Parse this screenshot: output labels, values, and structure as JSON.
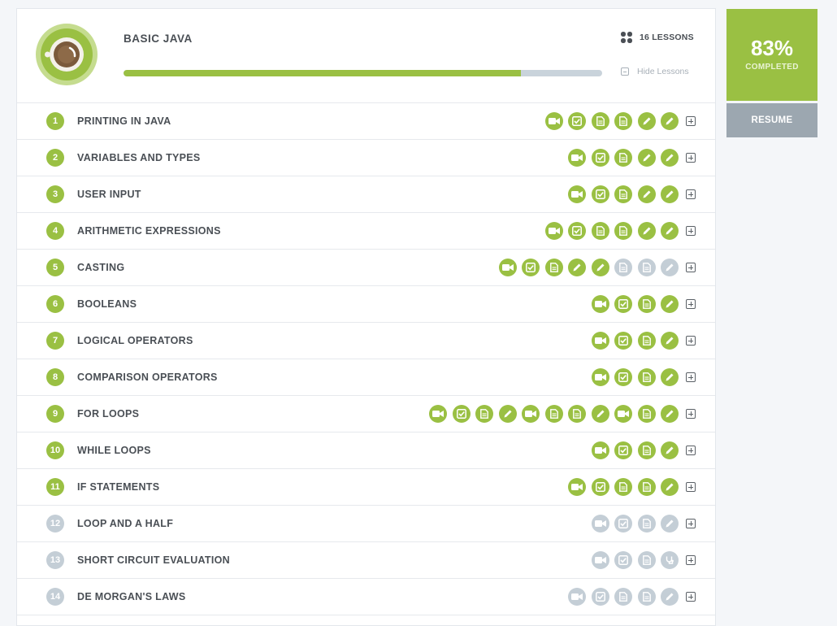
{
  "course": {
    "title": "BASIC JAVA",
    "lessons_count": "16 LESSONS",
    "hide_lessons_label": "Hide Lessons",
    "progress_fraction": 0.83
  },
  "side": {
    "percent": "83%",
    "completed_label": "COMPLETED",
    "resume_label": "RESUME"
  },
  "colors": {
    "accent_green": "#9ac043",
    "incomplete_gray": "#c4ced6",
    "resume_gray": "#9ca7b0"
  },
  "lessons": [
    {
      "num": "1",
      "title": "PRINTING IN JAVA",
      "done": true,
      "items": [
        [
          "video-icon",
          1
        ],
        [
          "checkbox-icon",
          1
        ],
        [
          "document-icon",
          1
        ],
        [
          "document-icon",
          1
        ],
        [
          "pencil-icon",
          1
        ],
        [
          "pencil-icon",
          1
        ]
      ]
    },
    {
      "num": "2",
      "title": "VARIABLES AND TYPES",
      "done": true,
      "items": [
        [
          "video-icon",
          1
        ],
        [
          "checkbox-icon",
          1
        ],
        [
          "document-icon",
          1
        ],
        [
          "pencil-icon",
          1
        ],
        [
          "pencil-icon",
          1
        ]
      ]
    },
    {
      "num": "3",
      "title": "USER INPUT",
      "done": true,
      "items": [
        [
          "video-icon",
          1
        ],
        [
          "checkbox-icon",
          1
        ],
        [
          "document-icon",
          1
        ],
        [
          "pencil-icon",
          1
        ],
        [
          "pencil-icon",
          1
        ]
      ]
    },
    {
      "num": "4",
      "title": "ARITHMETIC EXPRESSIONS",
      "done": true,
      "items": [
        [
          "video-icon",
          1
        ],
        [
          "checkbox-icon",
          1
        ],
        [
          "document-icon",
          1
        ],
        [
          "document-icon",
          1
        ],
        [
          "pencil-icon",
          1
        ],
        [
          "pencil-icon",
          1
        ]
      ]
    },
    {
      "num": "5",
      "title": "CASTING",
      "done": true,
      "items": [
        [
          "video-icon",
          1
        ],
        [
          "checkbox-icon",
          1
        ],
        [
          "document-icon",
          1
        ],
        [
          "pencil-icon",
          1
        ],
        [
          "pencil-icon",
          1
        ],
        [
          "document-icon",
          0
        ],
        [
          "document-icon",
          0
        ],
        [
          "pencil-icon",
          0
        ]
      ]
    },
    {
      "num": "6",
      "title": "BOOLEANS",
      "done": true,
      "items": [
        [
          "video-icon",
          1
        ],
        [
          "checkbox-icon",
          1
        ],
        [
          "document-icon",
          1
        ],
        [
          "pencil-icon",
          1
        ]
      ]
    },
    {
      "num": "7",
      "title": "LOGICAL OPERATORS",
      "done": true,
      "items": [
        [
          "video-icon",
          1
        ],
        [
          "checkbox-icon",
          1
        ],
        [
          "document-icon",
          1
        ],
        [
          "pencil-icon",
          1
        ]
      ]
    },
    {
      "num": "8",
      "title": "COMPARISON OPERATORS",
      "done": true,
      "items": [
        [
          "video-icon",
          1
        ],
        [
          "checkbox-icon",
          1
        ],
        [
          "document-icon",
          1
        ],
        [
          "pencil-icon",
          1
        ]
      ]
    },
    {
      "num": "9",
      "title": "FOR LOOPS",
      "done": true,
      "items": [
        [
          "video-icon",
          1
        ],
        [
          "checkbox-icon",
          1
        ],
        [
          "document-icon",
          1
        ],
        [
          "pencil-icon",
          1
        ],
        [
          "video-icon",
          1
        ],
        [
          "document-icon",
          1
        ],
        [
          "document-icon",
          1
        ],
        [
          "pencil-icon",
          1
        ],
        [
          "video-icon",
          1
        ],
        [
          "document-icon",
          1
        ],
        [
          "pencil-icon",
          1
        ]
      ]
    },
    {
      "num": "10",
      "title": "WHILE LOOPS",
      "done": true,
      "items": [
        [
          "video-icon",
          1
        ],
        [
          "checkbox-icon",
          1
        ],
        [
          "document-icon",
          1
        ],
        [
          "pencil-icon",
          1
        ]
      ]
    },
    {
      "num": "11",
      "title": "IF STATEMENTS",
      "done": true,
      "items": [
        [
          "video-icon",
          1
        ],
        [
          "checkbox-icon",
          1
        ],
        [
          "document-icon",
          1
        ],
        [
          "document-icon",
          1
        ],
        [
          "pencil-icon",
          1
        ]
      ]
    },
    {
      "num": "12",
      "title": "LOOP AND A HALF",
      "done": false,
      "items": [
        [
          "video-icon",
          0
        ],
        [
          "checkbox-icon",
          0
        ],
        [
          "document-icon",
          0
        ],
        [
          "pencil-icon",
          0
        ]
      ]
    },
    {
      "num": "13",
      "title": "SHORT CIRCUIT EVALUATION",
      "done": false,
      "items": [
        [
          "video-icon",
          0
        ],
        [
          "checkbox-icon",
          0
        ],
        [
          "document-icon",
          0
        ],
        [
          "stethoscope-icon",
          0
        ]
      ]
    },
    {
      "num": "14",
      "title": "DE MORGAN'S LAWS",
      "done": false,
      "items": [
        [
          "video-icon",
          0
        ],
        [
          "checkbox-icon",
          0
        ],
        [
          "document-icon",
          0
        ],
        [
          "document-icon",
          0
        ],
        [
          "pencil-icon",
          0
        ]
      ]
    }
  ]
}
